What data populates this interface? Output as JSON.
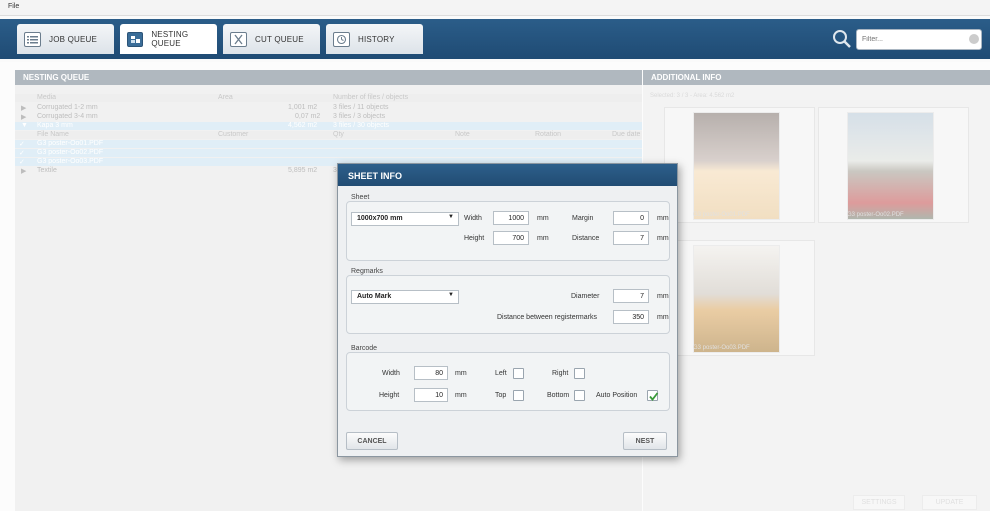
{
  "menu": {
    "file": "File"
  },
  "tabs": [
    {
      "label": "JOB QUEUE",
      "icon": "list-icon"
    },
    {
      "label": "NESTING QUEUE",
      "icon": "nesting-icon"
    },
    {
      "label": "CUT QUEUE",
      "icon": "cut-icon"
    },
    {
      "label": "HISTORY",
      "icon": "history-icon"
    }
  ],
  "filter": {
    "placeholder": "Filter..."
  },
  "nesting_queue": {
    "title": "NESTING QUEUE",
    "columns": [
      "Media",
      "Area",
      "Number of files / objects"
    ],
    "rows": [
      {
        "media": "Corrugated 1-2 mm",
        "area": "1,001 m2",
        "count": "3 files / 11 objects"
      },
      {
        "media": "Corrugated 3-4 mm",
        "area": "0,07 m2",
        "count": "3 files / 3 objects"
      },
      {
        "media": "Kapa 3 mm",
        "area": "4,562 m2",
        "count": "3 files / 30 objects"
      }
    ],
    "file_columns": [
      "File Name",
      "Customer",
      "Qty",
      "Note",
      "Rotation",
      "Due date"
    ],
    "files": [
      "G3 poster-Oo01.PDF",
      "G3 poster-Oo02.PDF",
      "G3 poster-Oo03.PDF"
    ],
    "last_row": {
      "media": "Textile",
      "area": "5,895 m2",
      "count": "3"
    }
  },
  "additional_info": {
    "title": "ADDITIONAL INFO",
    "selected": "Selected: 3 / 3  -  Area: 4.562 m2",
    "thumbs": [
      "G3 poster-Oo01.PDF",
      "G3 poster-Oo02.PDF",
      "G3 poster-Oo03.PDF"
    ],
    "settings": "SETTINGS",
    "update": "UPDATE"
  },
  "dialog": {
    "title": "SHEET INFO",
    "sheet": {
      "label": "Sheet",
      "size": "1000x700 mm",
      "width_label": "Width",
      "width": "1000",
      "height_label": "Height",
      "height": "700",
      "margin_label": "Margin",
      "margin": "0",
      "distance_label": "Distance",
      "distance": "7",
      "unit": "mm"
    },
    "regmarks": {
      "label": "Regmarks",
      "type": "Auto Mark",
      "diameter_label": "Diameter",
      "diameter": "7",
      "between_label": "Distance between registermarks",
      "between": "350",
      "unit": "mm"
    },
    "barcode": {
      "label": "Barcode",
      "width_label": "Width",
      "width": "80",
      "height_label": "Height",
      "height": "10",
      "unit": "mm",
      "left_label": "Left",
      "right_label": "Right",
      "top_label": "Top",
      "bottom_label": "Bottom",
      "auto_label": "Auto Position",
      "left": false,
      "right": false,
      "top": false,
      "bottom": false,
      "auto": true
    },
    "cancel": "CANCEL",
    "nest": "NEST"
  },
  "colors": {
    "header_blue": "#2b5d89",
    "check_green": "#3a9a3a",
    "selection_blue": "#c7e1f1"
  }
}
